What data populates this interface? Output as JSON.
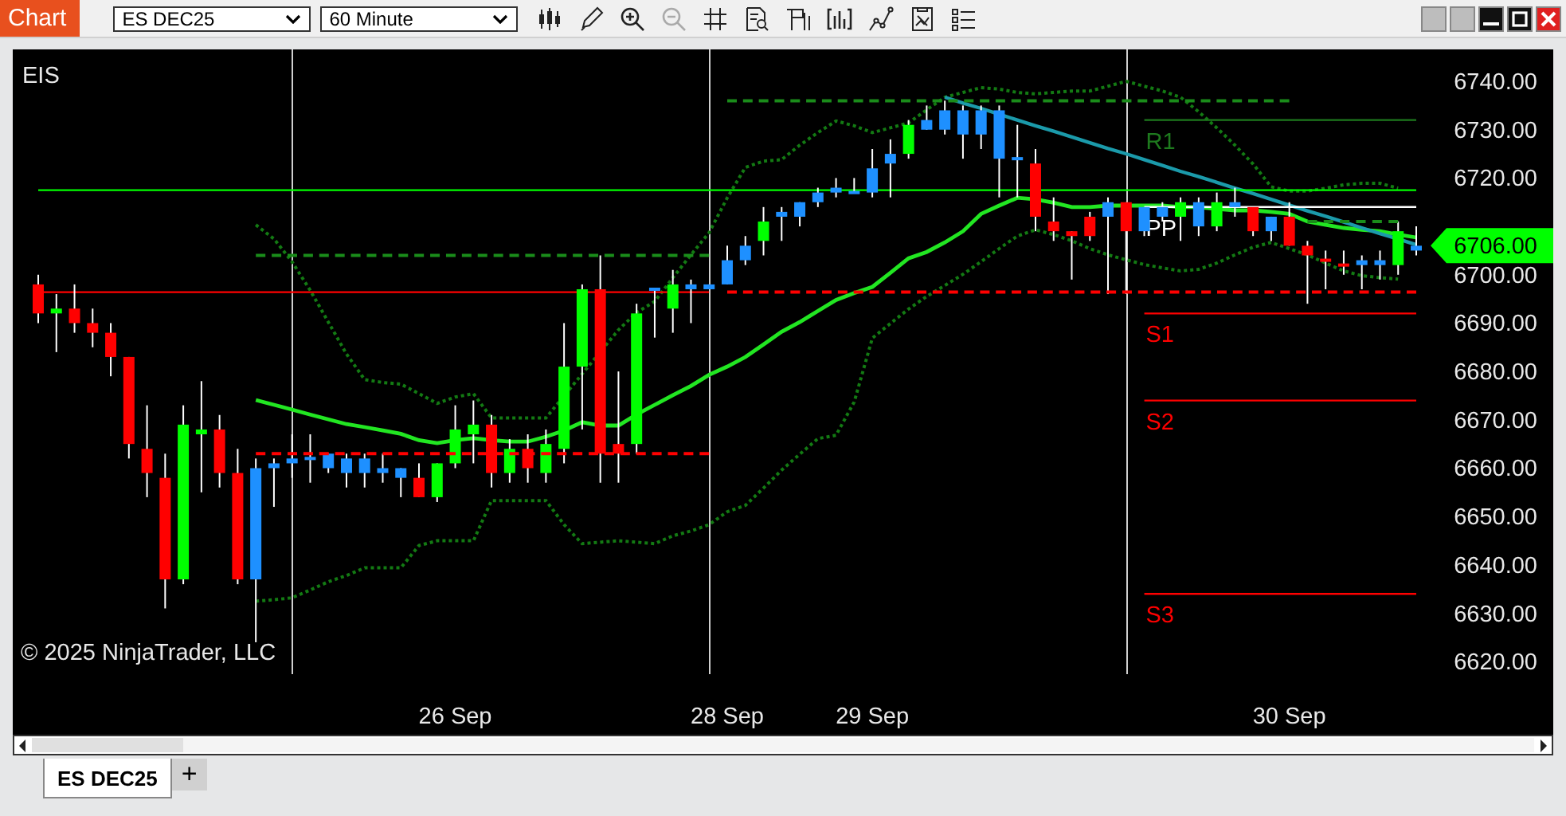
{
  "window": {
    "title": "Chart",
    "instrument": "ES DEC25",
    "interval": "60 Minute"
  },
  "chart": {
    "indicator_label": "EIS",
    "copyright": "© 2025 NinjaTrader, LLC",
    "chart_data": {
      "type": "candlestick",
      "categories": [
        null,
        null,
        null,
        null,
        null,
        null,
        null,
        null,
        null,
        null,
        null,
        null,
        null,
        null,
        null,
        null,
        null,
        null,
        null,
        null,
        null,
        null,
        null,
        "26 Sep",
        null,
        null,
        null,
        null,
        null,
        null,
        null,
        null,
        null,
        null,
        null,
        null,
        null,
        null,
        "28 Sep",
        null,
        null,
        null,
        null,
        null,
        null,
        null,
        "29 Sep",
        null,
        null,
        null,
        null,
        null,
        null,
        null,
        null,
        null,
        null,
        null,
        null,
        null,
        null,
        null,
        null,
        null,
        null,
        null,
        null,
        null,
        null,
        "30 Sep",
        null,
        null,
        null,
        null,
        null,
        null,
        null
      ],
      "ylim": [
        6617.4,
        6746.6
      ],
      "series": [
        {
          "color": "#ff0000",
          "ohlc": [
            [
              6698,
              6700,
              6690,
              6692
            ],
            null,
            [
              6693,
              6698,
              6688,
              6690
            ],
            [
              6690,
              6693,
              6685,
              6688
            ],
            [
              6688,
              6690,
              6679,
              6683
            ],
            [
              6683,
              6683,
              6662,
              6665
            ],
            [
              6664,
              6673,
              6654,
              6659
            ],
            [
              6658,
              6663,
              6631,
              6637
            ],
            null,
            null,
            [
              6668,
              6671,
              6656,
              6659
            ],
            [
              6659,
              6664,
              6636,
              6637
            ],
            null,
            null,
            null,
            null,
            null,
            null,
            null,
            null,
            null,
            [
              6658,
              6661,
              6654,
              6654
            ],
            null,
            null,
            null,
            [
              6669,
              6671,
              6656,
              6659
            ],
            null,
            [
              6664,
              6667,
              6657,
              6660
            ],
            null,
            null,
            null,
            [
              6697,
              6704,
              6657,
              6663
            ],
            [
              6665,
              6680,
              6657,
              6663
            ],
            null,
            null,
            null,
            null,
            null,
            null,
            null,
            null,
            null,
            null,
            null,
            null,
            null,
            null,
            null,
            null,
            null,
            null,
            null,
            null,
            null,
            null,
            [
              6723,
              6726,
              6709,
              6712
            ],
            [
              6711,
              6716,
              6707,
              6709
            ],
            [
              6709,
              6709,
              6699,
              6708
            ],
            [
              6712,
              6713,
              6707,
              6708
            ],
            null,
            [
              6715,
              6715,
              6696,
              6709
            ],
            null,
            null,
            null,
            null,
            null,
            null,
            [
              6714,
              6714,
              6708,
              6709
            ],
            null,
            [
              6712,
              6715,
              6706,
              6706
            ],
            [
              6706,
              6707,
              6694,
              6704
            ],
            [
              6703,
              6705,
              6697,
              6703
            ],
            [
              6702,
              6705,
              6700,
              6702
            ],
            null,
            null,
            null,
            null
          ]
        },
        {
          "color": "#00ff00",
          "ohlc": [
            null,
            [
              6692,
              6696,
              6684,
              6693
            ],
            null,
            null,
            null,
            null,
            null,
            null,
            [
              6637,
              6673,
              6636,
              6669
            ],
            [
              6667,
              6678,
              6655,
              6668
            ],
            null,
            null,
            null,
            null,
            null,
            null,
            null,
            null,
            null,
            null,
            null,
            null,
            [
              6654,
              6661,
              6653,
              6661
            ],
            [
              6661,
              6673,
              6660,
              6668
            ],
            [
              6667,
              6674,
              6661,
              6669
            ],
            null,
            [
              6659,
              6666,
              6657,
              6664
            ],
            null,
            [
              6659,
              6668,
              6657,
              6665
            ],
            [
              6664,
              6690,
              6661,
              6681
            ],
            [
              6681,
              6698,
              6668,
              6697
            ],
            null,
            null,
            [
              6665,
              6694,
              6663,
              6692
            ],
            null,
            [
              6693,
              6701,
              6688,
              6698
            ],
            null,
            null,
            null,
            null,
            [
              6707,
              6714,
              6704,
              6711
            ],
            null,
            null,
            null,
            null,
            null,
            null,
            null,
            [
              6725,
              6732,
              6724,
              6731
            ],
            null,
            null,
            null,
            null,
            null,
            null,
            null,
            null,
            null,
            null,
            null,
            null,
            null,
            null,
            [
              6712,
              6716,
              6707,
              6715
            ],
            null,
            [
              6710,
              6717,
              6709,
              6715
            ],
            null,
            null,
            null,
            null,
            null,
            null,
            null,
            null,
            null,
            [
              6702,
              6711,
              6700,
              6709
            ],
            null
          ]
        },
        {
          "color": "#1e90ff",
          "ohlc": [
            null,
            null,
            null,
            null,
            null,
            null,
            null,
            null,
            null,
            null,
            null,
            null,
            [
              6637,
              6662,
              6624,
              6660
            ],
            [
              6660,
              6662,
              6652,
              6661
            ],
            [
              6661,
              6667,
              6658,
              6662
            ],
            [
              6662,
              6667,
              6657,
              6662
            ],
            [
              6660,
              6663,
              6659,
              6663
            ],
            [
              6659,
              6663,
              6656,
              6662
            ],
            [
              6659,
              6663,
              6656,
              6662
            ],
            [
              6659,
              6663,
              6657,
              6660
            ],
            [
              6658,
              6660,
              6654,
              6660
            ],
            null,
            null,
            null,
            null,
            null,
            null,
            null,
            null,
            null,
            null,
            null,
            null,
            null,
            [
              6697,
              6697,
              6687,
              6697
            ],
            null,
            [
              6697,
              6699,
              6690,
              6698
            ],
            [
              6697,
              6698,
              6697,
              6698
            ],
            [
              6698,
              6706,
              6698,
              6703
            ],
            [
              6703,
              6708,
              6702,
              6706
            ],
            null,
            [
              6712,
              6714,
              6707,
              6713
            ],
            [
              6712,
              6715,
              6710,
              6715
            ],
            [
              6715,
              6718,
              6714,
              6717
            ],
            [
              6717,
              6720,
              6716,
              6718
            ],
            [
              6717,
              6720,
              6717,
              6717
            ],
            [
              6717,
              6726,
              6716,
              6722
            ],
            [
              6723,
              6728,
              6716,
              6725
            ],
            null,
            [
              6730,
              6735,
              6730,
              6732
            ],
            [
              6730,
              6736,
              6729,
              6734
            ],
            [
              6729,
              6735,
              6724,
              6734
            ],
            [
              6729,
              6735,
              6726,
              6734
            ],
            [
              6724,
              6735,
              6716,
              6734
            ],
            [
              6724,
              6731,
              6716,
              6724
            ],
            null,
            null,
            null,
            null,
            [
              6712,
              6716,
              6696,
              6715
            ],
            null,
            [
              6709,
              6714,
              6708,
              6714
            ],
            [
              6712,
              6715,
              6711,
              6714
            ],
            null,
            [
              6710,
              6716,
              6708,
              6715
            ],
            null,
            [
              6714,
              6718,
              6712,
              6715
            ],
            null,
            [
              6709,
              6712,
              6707,
              6712
            ],
            null,
            null,
            null,
            null,
            [
              6702,
              6704,
              6697,
              6703
            ],
            [
              6702,
              6705,
              6699,
              6703
            ],
            null,
            [
              6705,
              6710,
              6704,
              6706
            ]
          ]
        },
        {
          "type": "line",
          "color": "#22e622",
          "values": [
            null,
            null,
            null,
            null,
            null,
            null,
            null,
            null,
            null,
            null,
            null,
            null,
            6674.1,
            6673.1,
            6672.1,
            6671.1,
            6670.1,
            6669.1,
            6668.5,
            6667.8,
            6667.1,
            6665.8,
            6665.2,
            6665.8,
            6666.2,
            6665.8,
            6665.5,
            6665.5,
            6666.5,
            6667.8,
            6669.5,
            6668.8,
            6668.8,
            6671.1,
            6673.1,
            6675.1,
            6677.0,
            6679.3,
            6681.0,
            6683.0,
            6685.6,
            6688.2,
            6690.2,
            6692.5,
            6694.8,
            6696.2,
            6697.5,
            6700.4,
            6703.4,
            6704.7,
            6706.7,
            6709.0,
            6712.6,
            6714.3,
            6715.9,
            6715.6,
            6714.9,
            6714.0,
            6714.0,
            6714.3,
            6714.3,
            6714.3,
            6714.3,
            6714.0,
            6714.0,
            6713.6,
            6713.3,
            6713.3,
            6713.0,
            6712.6,
            6711.0,
            6710.3,
            6709.7,
            6709.3,
            6709.0,
            6708.3,
            6707.7
          ]
        },
        {
          "type": "line",
          "line_style": "dotted",
          "color": "#137a13",
          "values": [
            null,
            null,
            null,
            null,
            null,
            null,
            null,
            null,
            null,
            null,
            null,
            null,
            6710.3,
            6707.4,
            6702.7,
            6696.8,
            6690.2,
            6683.6,
            6678.3,
            6677.7,
            6677.4,
            6675.4,
            6673.4,
            6674.7,
            6675.4,
            6670.4,
            6670.4,
            6670.4,
            6670.4,
            null,
            null,
            null,
            6688.6,
            6692.2,
            6694.5,
            6699.4,
            6704.1,
            6708.7,
            6715.9,
            6722.2,
            6723.5,
            6723.8,
            6726.8,
            6729.4,
            6731.8,
            6730.8,
            6729.4,
            6730.4,
            6731.4,
            6734.1,
            6736.7,
            6737.7,
            6738.7,
            6738.4,
            6737.7,
            6737.4,
            6737.7,
            6738.0,
            6738.0,
            6739.0,
            6740.0,
            6739.0,
            6738.0,
            6736.7,
            6733.7,
            6730.4,
            6726.8,
            6722.9,
            6718.2,
            6717.3,
            6717.3,
            6717.9,
            6718.6,
            6718.9,
            6718.9,
            6717.9,
            null
          ]
        },
        {
          "type": "line",
          "line_style": "dotted",
          "color": "#137a13",
          "values": [
            null,
            null,
            null,
            null,
            null,
            null,
            null,
            null,
            null,
            null,
            null,
            null,
            6632.5,
            6632.8,
            6633.2,
            6634.8,
            6636.5,
            6637.8,
            6639.4,
            6639.4,
            6639.4,
            6644.0,
            6645.0,
            6645.0,
            6645.0,
            6653.3,
            6653.3,
            6653.3,
            6653.3,
            6648.3,
            6644.4,
            6644.7,
            6645.0,
            6644.7,
            6644.4,
            6646.0,
            6647.0,
            6648.3,
            6651.0,
            6652.3,
            6655.9,
            6659.6,
            6662.9,
            6666.1,
            6666.8,
            6673.7,
            6686.9,
            6689.9,
            6692.9,
            6695.5,
            6697.8,
            6700.1,
            6702.7,
            6705.4,
            6708.0,
            6709.3,
            6708.3,
            6707.0,
            6705.4,
            6704.1,
            6703.1,
            6702.1,
            6701.4,
            6700.8,
            6701.1,
            6702.4,
            6704.1,
            6705.7,
            6706.7,
            6705.4,
            6704.1,
            6702.4,
            6700.8,
            6699.8,
            6699.4,
            6699.1,
            null
          ]
        },
        {
          "type": "line",
          "color": "#1b9aaa",
          "values": [
            null,
            null,
            null,
            null,
            null,
            null,
            null,
            null,
            null,
            null,
            null,
            null,
            null,
            null,
            null,
            null,
            null,
            null,
            null,
            null,
            null,
            null,
            null,
            null,
            null,
            null,
            null,
            null,
            null,
            null,
            null,
            null,
            null,
            null,
            null,
            null,
            null,
            null,
            null,
            null,
            null,
            null,
            null,
            null,
            null,
            null,
            null,
            null,
            null,
            null,
            6736.7,
            6735.5,
            6734.4,
            6733.2,
            6732.0,
            6730.8,
            6729.7,
            6728.5,
            6727.3,
            6726.1,
            6725.0,
            6723.8,
            6722.6,
            6721.4,
            6720.3,
            6719.1,
            6717.9,
            6716.8,
            6715.6,
            6714.4,
            6713.2,
            6712.1,
            6710.9,
            6709.7,
            6708.5,
            6707.4,
            6706.2
          ]
        },
        {
          "type": "line",
          "color": "#00ff00",
          "values": [
            6717.5,
            6717.5,
            6717.5,
            6717.5,
            6717.5,
            6717.5,
            6717.5,
            6717.5,
            6717.5,
            6717.5,
            6717.5,
            6717.5,
            6717.5,
            6717.5,
            6717.5,
            6717.5,
            6717.5,
            6717.5,
            6717.5,
            6717.5,
            6717.5,
            6717.5,
            6717.5,
            6717.5,
            6717.5,
            6717.5,
            6717.5,
            6717.5,
            6717.5,
            6717.5,
            6717.5,
            6717.5,
            6717.5,
            6717.5,
            6717.5,
            6717.5,
            6717.5,
            6717.5,
            6717.5,
            6717.5,
            6717.5,
            6717.5,
            6717.5,
            6717.5,
            6717.5,
            6717.5,
            6717.5,
            6717.5,
            6717.5,
            6717.5,
            6717.5,
            6717.5,
            6717.5,
            6717.5,
            6717.5,
            6717.5,
            6717.5,
            6717.5,
            6717.5,
            6717.5,
            6717.5,
            6717.5,
            6717.5,
            6717.5,
            6717.5,
            6717.5,
            6717.5,
            6717.5,
            6717.5,
            6717.5,
            6717.5,
            6717.5,
            6717.5,
            6717.5,
            6717.5,
            6717.5,
            6717.5
          ]
        },
        {
          "type": "line",
          "color": "#ff0000",
          "values": [
            6696.4,
            6696.4,
            6696.4,
            6696.4,
            6696.4,
            6696.4,
            6696.4,
            6696.4,
            6696.4,
            6696.4,
            6696.4,
            6696.4,
            6696.4,
            6696.4,
            6696.4,
            6696.4,
            6696.4,
            6696.4,
            6696.4,
            6696.4,
            6696.4,
            6696.4,
            6696.4,
            6696.4,
            6696.4,
            6696.4,
            6696.4,
            6696.4,
            6696.4,
            6696.4,
            6696.4,
            6696.4,
            6696.4,
            6696.4,
            6696.4,
            6696.4,
            6696.4,
            6696.4,
            null,
            null,
            null,
            null,
            null,
            null,
            null,
            null,
            null,
            null,
            null,
            null,
            null,
            null,
            null,
            null,
            null,
            null,
            null,
            null,
            null,
            null,
            null,
            null,
            null,
            null,
            null,
            null,
            null,
            null,
            null,
            null,
            null,
            null,
            null,
            null,
            null,
            null,
            null
          ]
        },
        {
          "type": "line",
          "line_style": "dashed",
          "color": "#ff0000",
          "values": [
            null,
            null,
            null,
            null,
            null,
            null,
            null,
            null,
            null,
            null,
            null,
            null,
            null,
            null,
            null,
            null,
            null,
            null,
            null,
            null,
            null,
            null,
            null,
            null,
            null,
            null,
            null,
            null,
            null,
            null,
            null,
            null,
            null,
            null,
            null,
            null,
            null,
            null,
            6696.4,
            6696.4,
            6696.4,
            6696.4,
            6696.4,
            6696.4,
            6696.4,
            6696.4,
            6696.4,
            6696.4,
            6696.4,
            6696.4,
            6696.4,
            6696.4,
            6696.4,
            6696.4,
            6696.4,
            6696.4,
            6696.4,
            6696.4,
            6696.4,
            6696.4,
            6696.4,
            6696.4,
            6696.4,
            6696.4,
            6696.4,
            6696.4,
            6696.4,
            6696.4,
            6696.4,
            6696.4,
            6696.4,
            6696.4,
            6696.4,
            6696.4,
            6696.4,
            6696.4,
            6696.4
          ]
        },
        {
          "type": "line",
          "line_style": "dashed",
          "color": "#1a8c1a",
          "values": [
            null,
            null,
            null,
            null,
            null,
            null,
            null,
            null,
            null,
            null,
            null,
            null,
            6704,
            6704,
            6704,
            6704,
            6704,
            6704,
            6704,
            6704,
            6704,
            6704,
            6704,
            6704,
            6704,
            6704,
            6704,
            6704,
            6704,
            6704,
            6704,
            6704,
            6704,
            6704,
            6704,
            6704,
            6704,
            6704,
            null,
            null,
            null,
            null,
            null,
            null,
            null,
            null,
            null,
            null,
            null,
            null,
            null,
            null,
            null,
            null,
            null,
            null,
            null,
            null,
            null,
            null,
            null,
            null,
            null,
            null,
            null,
            null,
            null,
            null,
            null,
            null,
            null,
            null,
            null,
            null,
            null,
            null,
            null
          ]
        },
        {
          "type": "line",
          "line_style": "dashed",
          "color": "#ff0000",
          "values": [
            null,
            null,
            null,
            null,
            null,
            null,
            null,
            null,
            null,
            null,
            null,
            null,
            6663,
            6663,
            6663,
            6663,
            6663,
            6663,
            6663,
            6663,
            6663,
            6663,
            6663,
            6663,
            6663,
            6663,
            6663,
            6663,
            6663,
            6663,
            6663,
            6663,
            6663,
            6663,
            6663,
            6663,
            6663,
            6663,
            null,
            null,
            null,
            null,
            null,
            null,
            null,
            null,
            null,
            null,
            null,
            null,
            null,
            null,
            null,
            null,
            null,
            null,
            null,
            null,
            null,
            null,
            null,
            null,
            null,
            null,
            null,
            null,
            null,
            null,
            null,
            null,
            null,
            null,
            null,
            null,
            null,
            null,
            null
          ]
        },
        {
          "type": "line",
          "line_style": "dashed",
          "color": "#1a8c1a",
          "values": [
            null,
            null,
            null,
            null,
            null,
            null,
            null,
            null,
            null,
            null,
            null,
            null,
            null,
            null,
            null,
            null,
            null,
            null,
            null,
            null,
            null,
            null,
            null,
            null,
            null,
            null,
            null,
            null,
            null,
            null,
            null,
            null,
            null,
            null,
            null,
            null,
            null,
            null,
            6736,
            6736,
            6736,
            6736,
            6736,
            6736,
            6736,
            6736,
            6736,
            6736,
            6736,
            6736,
            6736,
            6736,
            6736,
            6736,
            6736,
            6736,
            6736,
            6736,
            6736,
            6736,
            6736,
            6736,
            6736,
            6736,
            6736,
            6736,
            6736,
            6736,
            6736,
            6736,
            null,
            null,
            null,
            null,
            null,
            null,
            null
          ]
        },
        {
          "type": "line",
          "line_style": "dashed",
          "color": "#1a8c1a",
          "values": [
            null,
            null,
            null,
            null,
            null,
            null,
            null,
            null,
            null,
            null,
            null,
            null,
            null,
            null,
            null,
            null,
            null,
            null,
            null,
            null,
            null,
            null,
            null,
            null,
            null,
            null,
            null,
            null,
            null,
            null,
            null,
            null,
            null,
            null,
            null,
            null,
            null,
            null,
            null,
            null,
            null,
            null,
            null,
            null,
            null,
            null,
            null,
            null,
            null,
            null,
            null,
            null,
            null,
            null,
            null,
            null,
            null,
            null,
            null,
            null,
            null,
            null,
            null,
            null,
            null,
            null,
            null,
            null,
            null,
            null,
            6711,
            6711,
            6711,
            6711,
            6711,
            6711,
            null
          ]
        },
        {
          "type": "line",
          "name": "R1",
          "color": "#1e7a1e",
          "values": [
            null,
            null,
            null,
            null,
            null,
            null,
            null,
            null,
            null,
            null,
            null,
            null,
            null,
            null,
            null,
            null,
            null,
            null,
            null,
            null,
            null,
            null,
            null,
            null,
            null,
            null,
            null,
            null,
            null,
            null,
            null,
            null,
            null,
            null,
            null,
            null,
            null,
            null,
            null,
            null,
            null,
            null,
            null,
            null,
            null,
            null,
            null,
            null,
            null,
            null,
            null,
            null,
            null,
            null,
            null,
            null,
            null,
            null,
            null,
            null,
            null,
            6732,
            6732,
            6732,
            6732,
            6732,
            6732,
            6732,
            6732,
            6732,
            6732,
            6732,
            6732,
            6732,
            6732,
            6732,
            6732
          ]
        },
        {
          "type": "line",
          "name": "PP",
          "color": "#ffffff",
          "values": [
            null,
            null,
            null,
            null,
            null,
            null,
            null,
            null,
            null,
            null,
            null,
            null,
            null,
            null,
            null,
            null,
            null,
            null,
            null,
            null,
            null,
            null,
            null,
            null,
            null,
            null,
            null,
            null,
            null,
            null,
            null,
            null,
            null,
            null,
            null,
            null,
            null,
            null,
            null,
            null,
            null,
            null,
            null,
            null,
            null,
            null,
            null,
            null,
            null,
            null,
            null,
            null,
            null,
            null,
            null,
            null,
            null,
            null,
            null,
            null,
            null,
            6714,
            6714,
            6714,
            6714,
            6714,
            6714,
            6714,
            6714,
            6714,
            6714,
            6714,
            6714,
            6714,
            6714,
            6714,
            6714
          ]
        },
        {
          "type": "line",
          "name": "S1",
          "color": "#ff0000",
          "values": [
            null,
            null,
            null,
            null,
            null,
            null,
            null,
            null,
            null,
            null,
            null,
            null,
            null,
            null,
            null,
            null,
            null,
            null,
            null,
            null,
            null,
            null,
            null,
            null,
            null,
            null,
            null,
            null,
            null,
            null,
            null,
            null,
            null,
            null,
            null,
            null,
            null,
            null,
            null,
            null,
            null,
            null,
            null,
            null,
            null,
            null,
            null,
            null,
            null,
            null,
            null,
            null,
            null,
            null,
            null,
            null,
            null,
            null,
            null,
            null,
            null,
            6692,
            6692,
            6692,
            6692,
            6692,
            6692,
            6692,
            6692,
            6692,
            6692,
            6692,
            6692,
            6692,
            6692,
            6692,
            6692
          ]
        },
        {
          "type": "line",
          "name": "S2",
          "color": "#ff0000",
          "values": [
            null,
            null,
            null,
            null,
            null,
            null,
            null,
            null,
            null,
            null,
            null,
            null,
            null,
            null,
            null,
            null,
            null,
            null,
            null,
            null,
            null,
            null,
            null,
            null,
            null,
            null,
            null,
            null,
            null,
            null,
            null,
            null,
            null,
            null,
            null,
            null,
            null,
            null,
            null,
            null,
            null,
            null,
            null,
            null,
            null,
            null,
            null,
            null,
            null,
            null,
            null,
            null,
            null,
            null,
            null,
            null,
            null,
            null,
            null,
            null,
            null,
            6674,
            6674,
            6674,
            6674,
            6674,
            6674,
            6674,
            6674,
            6674,
            6674,
            6674,
            6674,
            6674,
            6674,
            6674,
            6674
          ]
        },
        {
          "type": "line",
          "name": "S3",
          "color": "#ff0000",
          "values": [
            null,
            null,
            null,
            null,
            null,
            null,
            null,
            null,
            null,
            null,
            null,
            null,
            null,
            null,
            null,
            null,
            null,
            null,
            null,
            null,
            null,
            null,
            null,
            null,
            null,
            null,
            null,
            null,
            null,
            null,
            null,
            null,
            null,
            null,
            null,
            null,
            null,
            null,
            null,
            null,
            null,
            null,
            null,
            null,
            null,
            null,
            null,
            null,
            null,
            null,
            null,
            null,
            null,
            null,
            null,
            null,
            null,
            null,
            null,
            null,
            null,
            6634,
            6634,
            6634,
            6634,
            6634,
            6634,
            6634,
            6634,
            6634,
            6634,
            6634,
            6634,
            6634,
            6634,
            6634,
            6634
          ]
        }
      ],
      "yticks": [
        {
          "value": 6740,
          "label": "6740.00"
        },
        {
          "value": 6730,
          "label": "6730.00"
        },
        {
          "value": 6720,
          "label": "6720.00"
        },
        {
          "value": 6700,
          "label": "6700.00"
        },
        {
          "value": 6690,
          "label": "6690.00"
        },
        {
          "value": 6680,
          "label": "6680.00"
        },
        {
          "value": 6670,
          "label": "6670.00"
        },
        {
          "value": 6660,
          "label": "6660.00"
        },
        {
          "value": 6650,
          "label": "6650.00"
        },
        {
          "value": 6640,
          "label": "6640.00"
        },
        {
          "value": 6630,
          "label": "6630.00"
        },
        {
          "value": 6620,
          "label": "6620.00"
        }
      ],
      "annotations": [
        "6706.00"
      ]
    }
  },
  "tabs": [
    {
      "label": "ES DEC25",
      "selected": true
    }
  ],
  "add_tab": "+"
}
